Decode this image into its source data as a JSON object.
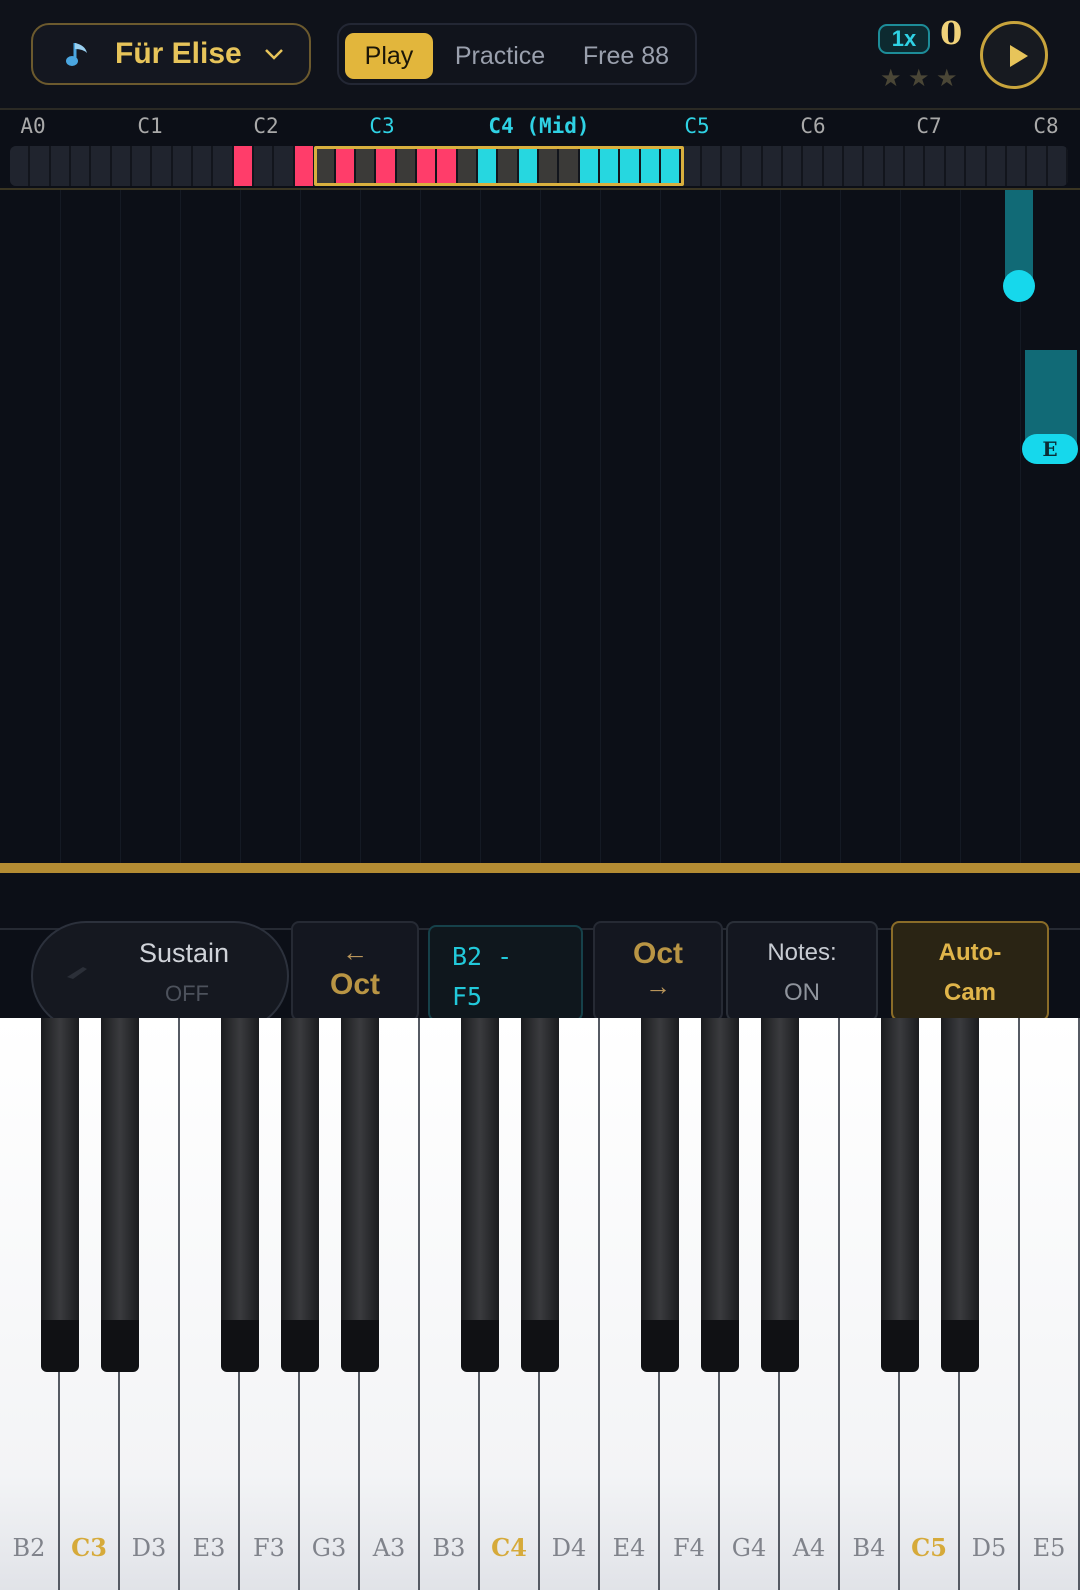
{
  "header": {
    "song_title": "Für Elise",
    "tabs": [
      {
        "label": "Play",
        "active": true
      },
      {
        "label": "Practice",
        "active": false
      },
      {
        "label": "Free 88",
        "active": false
      }
    ],
    "speed": "1x",
    "score": "0",
    "stars": [
      "★",
      "★",
      "★"
    ],
    "icons": {
      "song": "music-note-icon",
      "dropdown": "chevron-down-icon",
      "play": "play-icon"
    }
  },
  "keyboard_map": {
    "octave_labels": [
      "A0",
      "C1",
      "C2",
      "C3",
      "C4 (Mid)",
      "C5",
      "C6",
      "C7",
      "C8"
    ],
    "colors": {
      "left_hand": "#ff3d6a",
      "right_hand": "#26d7e0",
      "window": "#d9b03e"
    }
  },
  "highway": {
    "falling_note_label": "E",
    "note_color": "#16d8ec"
  },
  "controls": {
    "sustain_label": "Sustain",
    "sustain_state": "OFF",
    "oct_left_arrow": "←",
    "oct_left_label": "Oct",
    "range_line1": "B2 -",
    "range_line2": "F5",
    "oct_right_label": "Oct",
    "oct_right_arrow": "→",
    "notes_label": "Notes:",
    "notes_state": "ON",
    "autocam_line1": "Auto-",
    "autocam_line2": "Cam"
  },
  "piano": {
    "white_keys": [
      "B2",
      "C3",
      "D3",
      "E3",
      "F3",
      "G3",
      "A3",
      "B3",
      "C4",
      "D4",
      "E4",
      "F4",
      "G4",
      "A4",
      "B4",
      "C5",
      "D5",
      "E5"
    ],
    "black_keys": [
      "C#3",
      "D#3",
      "F#3",
      "G#3",
      "A#3",
      "C#4",
      "D#4",
      "F#4",
      "G#4",
      "A#4",
      "C#5",
      "D#5"
    ]
  }
}
